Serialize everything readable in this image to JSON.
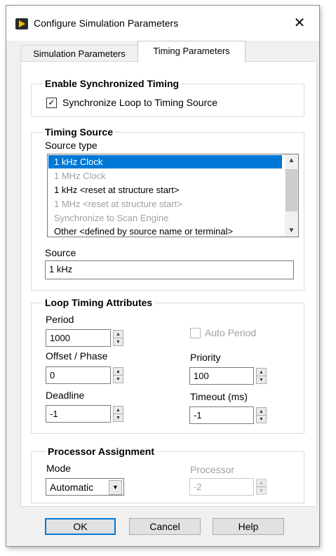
{
  "window": {
    "title": "Configure Simulation Parameters",
    "close_glyph": "✕",
    "icon": "labview-icon"
  },
  "tabs": [
    {
      "label": "Simulation Parameters",
      "active": false
    },
    {
      "label": "Timing Parameters",
      "active": true
    }
  ],
  "sync_group": {
    "title": "Enable Synchronized Timing",
    "checkbox_label": "Synchronize Loop to Timing Source",
    "checked": true,
    "check_glyph": "✓"
  },
  "timing_source": {
    "title": "Timing Source",
    "source_type_label": "Source type",
    "items": [
      {
        "label": "1 kHz Clock",
        "selected": true,
        "enabled": true
      },
      {
        "label": "1 MHz Clock",
        "selected": false,
        "enabled": false
      },
      {
        "label": "1 kHz <reset at structure start>",
        "selected": false,
        "enabled": true
      },
      {
        "label": "1 MHz <reset at structure start>",
        "selected": false,
        "enabled": false
      },
      {
        "label": "Synchronize to Scan Engine",
        "selected": false,
        "enabled": false
      },
      {
        "label": "Other <defined by source name or terminal>",
        "selected": false,
        "enabled": true
      }
    ],
    "scroll_up_glyph": "▲",
    "scroll_down_glyph": "▼",
    "source_label": "Source",
    "source_value": "1 kHz"
  },
  "loop_timing": {
    "title": "Loop Timing Attributes",
    "period_label": "Period",
    "period_value": "1000",
    "offset_label": "Offset / Phase",
    "offset_value": "0",
    "deadline_label": "Deadline",
    "deadline_value": "-1",
    "auto_period_label": "Auto Period",
    "auto_period_checked": false,
    "priority_label": "Priority",
    "priority_value": "100",
    "timeout_label": "Timeout (ms)",
    "timeout_value": "-1",
    "spin_up_glyph": "▲",
    "spin_down_glyph": "▼"
  },
  "processor": {
    "title": "Processor Assignment",
    "mode_label": "Mode",
    "mode_value": "Automatic",
    "dropdown_glyph": "▼",
    "processor_label": "Processor",
    "processor_value": "-2"
  },
  "buttons": {
    "ok": "OK",
    "cancel": "Cancel",
    "help": "Help"
  },
  "colors": {
    "selection": "#0078d7",
    "disabled_text": "#a0a0a0",
    "accent_icon": "#f6c000"
  }
}
